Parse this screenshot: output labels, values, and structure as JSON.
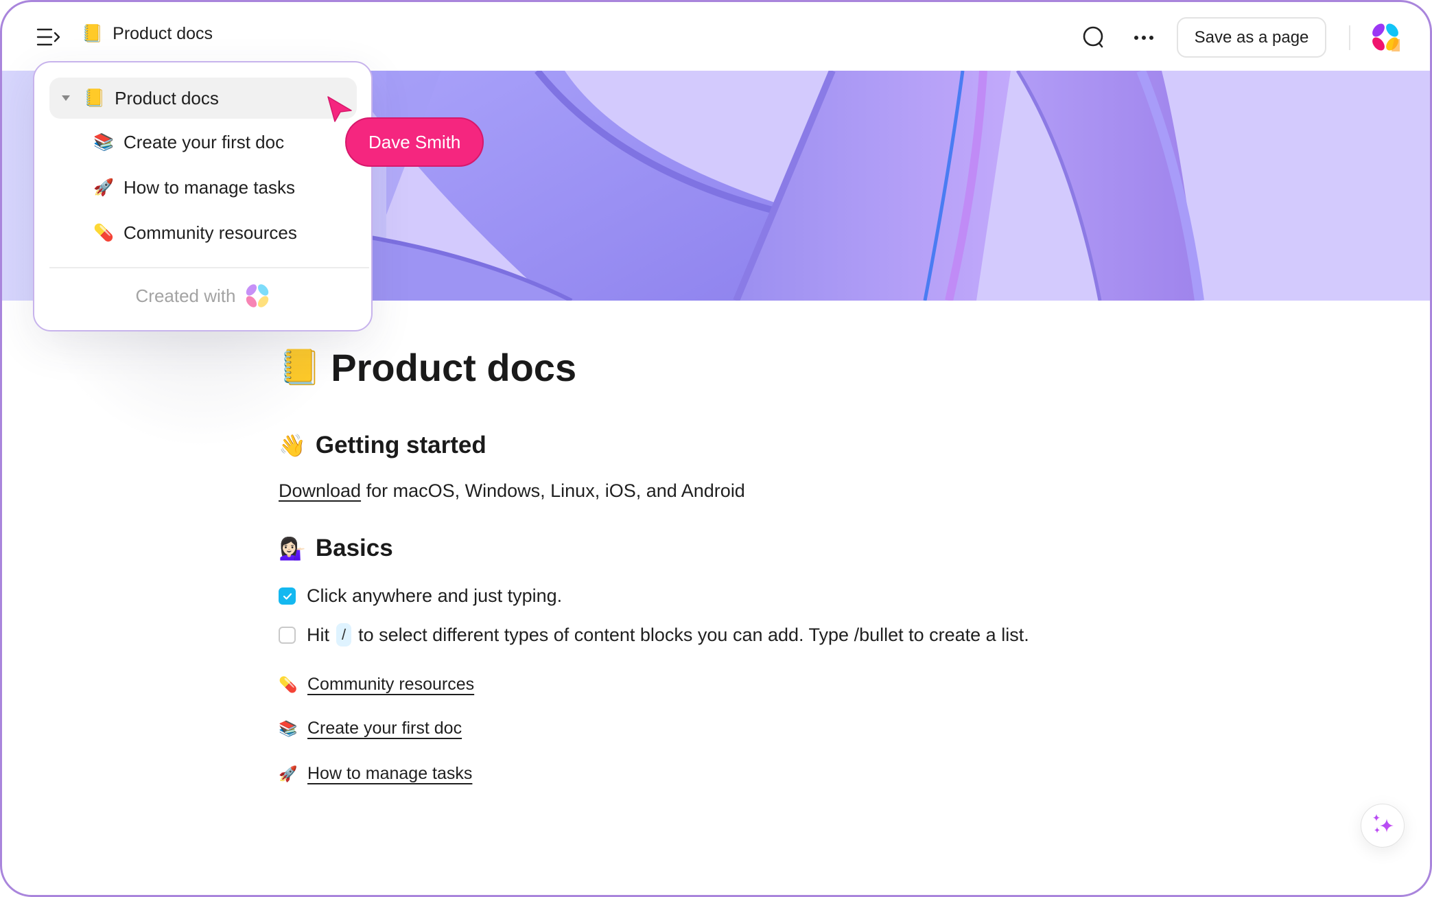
{
  "topbar": {
    "breadcrumb": {
      "emoji": "📒",
      "label": "Product docs"
    },
    "menu_icon": "sidebar-toggle-icon",
    "search_icon": "search-icon",
    "more_icon": "more-horizontal-icon",
    "save_label": "Save as a page",
    "logo": "app-logo"
  },
  "popover": {
    "root": {
      "emoji": "📒",
      "label": "Product docs",
      "expanded": true
    },
    "children": [
      {
        "emoji": "📚",
        "label": "Create your first doc"
      },
      {
        "emoji": "🚀",
        "label": "How to manage tasks"
      },
      {
        "emoji": "💊",
        "label": "Community resources"
      }
    ],
    "footer_label": "Created with"
  },
  "collaborator": {
    "name": "Dave Smith",
    "color": "#f5267f"
  },
  "doc": {
    "title": {
      "emoji": "📒",
      "text": "Product docs"
    },
    "sections": [
      {
        "heading": {
          "emoji": "👋",
          "text": "Getting started"
        },
        "paragraph": {
          "link": "Download",
          "rest": " for macOS, Windows, Linux, iOS, and Android"
        }
      },
      {
        "heading": {
          "emoji": "💁🏻‍♀️",
          "text": "Basics"
        }
      }
    ],
    "todos": [
      {
        "checked": true,
        "text": "Click anywhere and just typing."
      },
      {
        "checked": false,
        "prefix": "Hit",
        "kbd": "/",
        "text": "to select different types of content blocks you can add. Type /bullet to create a list."
      }
    ],
    "links": [
      {
        "emoji": "💊",
        "label": "Community resources"
      },
      {
        "emoji": "📚",
        "label": "Create your first doc"
      },
      {
        "emoji": "🚀",
        "label": "How to manage tasks"
      }
    ]
  },
  "ai_button": {
    "icon": "sparkles-icon"
  },
  "colors": {
    "window_border": "#a985dc",
    "banner_bg": "#d3cafd",
    "checkbox_checked": "#14b8f0",
    "collab_tag": "#f5267f",
    "sparkle": "#c24cf6"
  }
}
